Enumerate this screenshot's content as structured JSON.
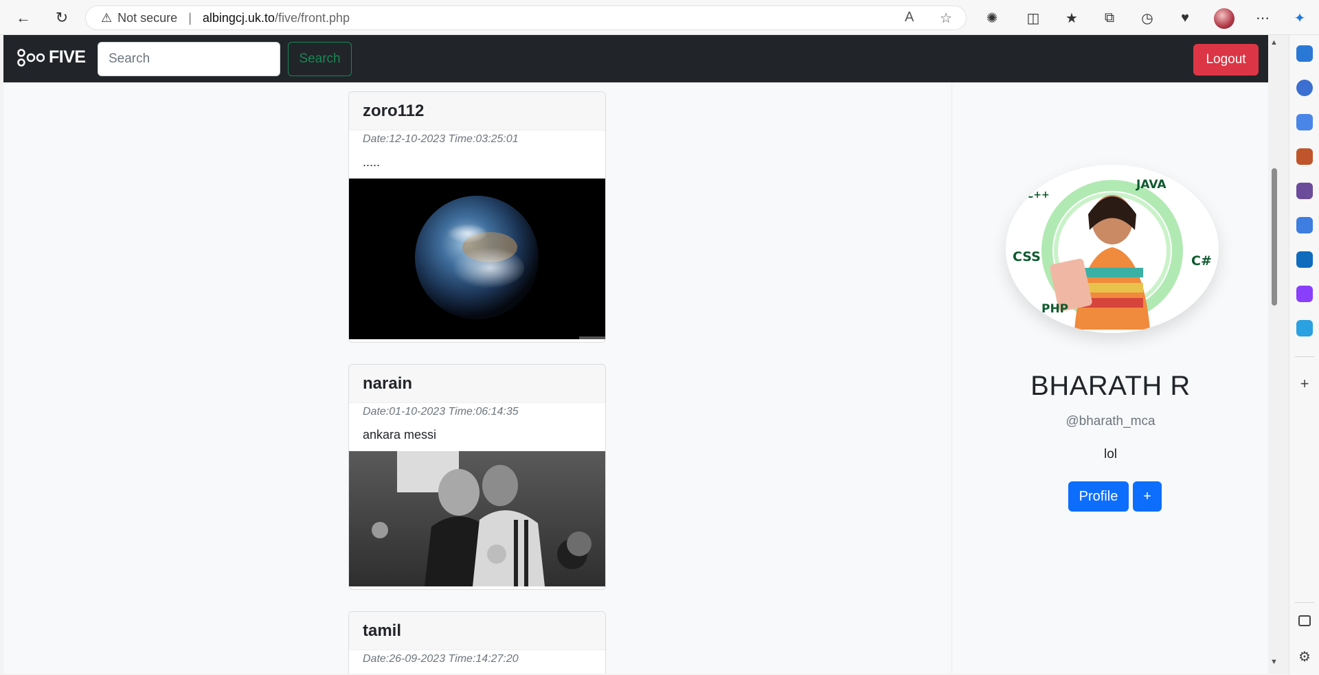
{
  "browser": {
    "security_label": "Not secure",
    "url_host": "albingcj.uk.to",
    "url_path": "/five/front.php"
  },
  "navbar": {
    "brand": "FIVE",
    "search_placeholder": "Search",
    "search_button": "Search",
    "logout_button": "Logout"
  },
  "posts": [
    {
      "author": "zoro112",
      "meta": "Date:12-10-2023 Time:03:25:01",
      "text": ".....",
      "image": "earth-in-space"
    },
    {
      "author": "narain",
      "meta": "Date:01-10-2023 Time:06:14:35",
      "text": "ankara messi",
      "image": "black-and-white-photo"
    },
    {
      "author": "tamil",
      "meta": "Date:26-09-2023 Time:14:27:20",
      "text": ""
    }
  ],
  "profile": {
    "name": "BHARATH R",
    "handle": "@bharath_mca",
    "bio": "lol",
    "profile_button": "Profile",
    "add_button": "+"
  },
  "profile_image_tags": [
    "JAVA",
    "C++",
    "CSS",
    "C#",
    "PHP"
  ],
  "colors": {
    "navbar_bg": "#212529",
    "success": "#198754",
    "danger": "#dc3545",
    "primary": "#0d6efd"
  }
}
